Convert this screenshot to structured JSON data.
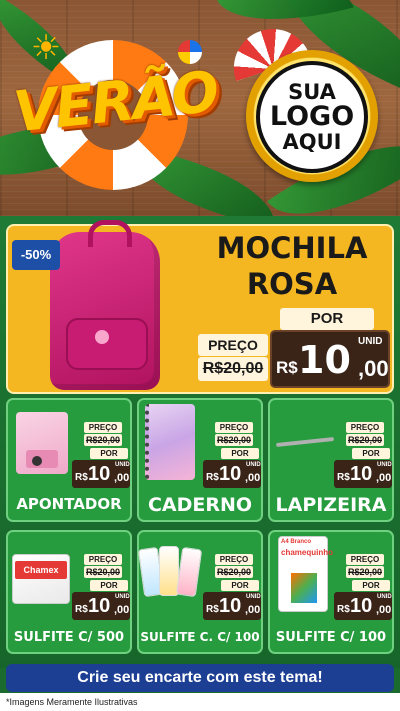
{
  "header": {
    "title": "VERÃO",
    "logo_line1": "SUA",
    "logo_line2": "LOGO",
    "logo_line3": "AQUI",
    "icons": [
      "sunglasses-sun-icon",
      "beach-ball-icon",
      "umbrella-icon",
      "lifebuoy-icon"
    ]
  },
  "featured": {
    "discount": "-50%",
    "name_line1": "MOCHILA",
    "name_line2": "ROSA",
    "por_label": "POR",
    "preco_label": "PREÇO",
    "old_price": "R$20,00",
    "currency": "R$",
    "price_int": "10",
    "price_dec": ",00",
    "unit": "UNID"
  },
  "products": [
    {
      "name": "APONTADOR",
      "preco_label": "PREÇO",
      "old_price": "R$20,00",
      "por_label": "POR",
      "currency": "R$",
      "price_int": "10",
      "price_dec": ",00",
      "unit": "UNID"
    },
    {
      "name": "CADERNO",
      "preco_label": "PREÇO",
      "old_price": "R$20,00",
      "por_label": "POR",
      "currency": "R$",
      "price_int": "10",
      "price_dec": ",00",
      "unit": "UNID"
    },
    {
      "name": "LAPIZEIRA",
      "preco_label": "PREÇO",
      "old_price": "R$20,00",
      "por_label": "POR",
      "currency": "R$",
      "price_int": "10",
      "price_dec": ",00",
      "unit": "UNID"
    },
    {
      "name": "SULFITE C/ 500",
      "preco_label": "PREÇO",
      "old_price": "R$20,00",
      "por_label": "POR",
      "currency": "R$",
      "price_int": "10",
      "price_dec": ",00",
      "unit": "UNID"
    },
    {
      "name": "SULFITE C. C/ 100",
      "preco_label": "PREÇO",
      "old_price": "R$20,00",
      "por_label": "POR",
      "currency": "R$",
      "price_int": "10",
      "price_dec": ",00",
      "unit": "UNID"
    },
    {
      "name": "SULFITE C/ 100",
      "preco_label": "PREÇO",
      "old_price": "R$20,00",
      "por_label": "POR",
      "currency": "R$",
      "price_int": "10",
      "price_dec": ",00",
      "unit": "UNID"
    }
  ],
  "product_images": {
    "sulfite_label": "Chamex",
    "chamequinho_label": "chamequinho",
    "chamequinho_brand": "A4 Branco"
  },
  "cta": {
    "label": "Crie seu encarte com este tema!"
  },
  "footer": {
    "note": "*Imagens Meramente Ilustrativas"
  },
  "colors": {
    "accent": "#f4b621",
    "card_green": "#269c3f",
    "banner_blue": "#1c3f93",
    "price_brown": "#3a2418"
  }
}
